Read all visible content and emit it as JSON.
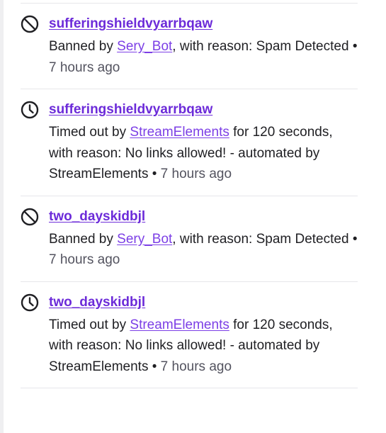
{
  "entries": [
    {
      "type": "ban",
      "icon": "ban-icon",
      "username": "sufferingshieldvyarrbqaw",
      "prefix": "Banned by ",
      "actor": "Sery_Bot",
      "suffix": ", with reason: Spam Detected",
      "bullet": " • ",
      "time": "7 hours ago"
    },
    {
      "type": "timeout",
      "icon": "clock-icon",
      "username": "sufferingshieldvyarrbqaw",
      "prefix": "Timed out by ",
      "actor": "StreamElements",
      "suffix": " for 120 seconds, with reason: No links allowed! - automated by StreamElements",
      "bullet": " • ",
      "time": "7 hours ago"
    },
    {
      "type": "ban",
      "icon": "ban-icon",
      "username": "two_dayskidbjl",
      "prefix": "Banned by ",
      "actor": "Sery_Bot",
      "suffix": ", with reason: Spam Detected",
      "bullet": " • ",
      "time": "7 hours ago"
    },
    {
      "type": "timeout",
      "icon": "clock-icon",
      "username": "two_dayskidbjl",
      "prefix": "Timed out by ",
      "actor": "StreamElements",
      "suffix": " for 120 seconds, with reason: No links allowed! - automated by StreamElements",
      "bullet": " • ",
      "time": "7 hours ago"
    }
  ],
  "colors": {
    "link": "#7c3fe6",
    "username": "#6c2bd9",
    "text": "#1f1f23",
    "muted": "#53535f",
    "divider": "#e6e6ea"
  }
}
